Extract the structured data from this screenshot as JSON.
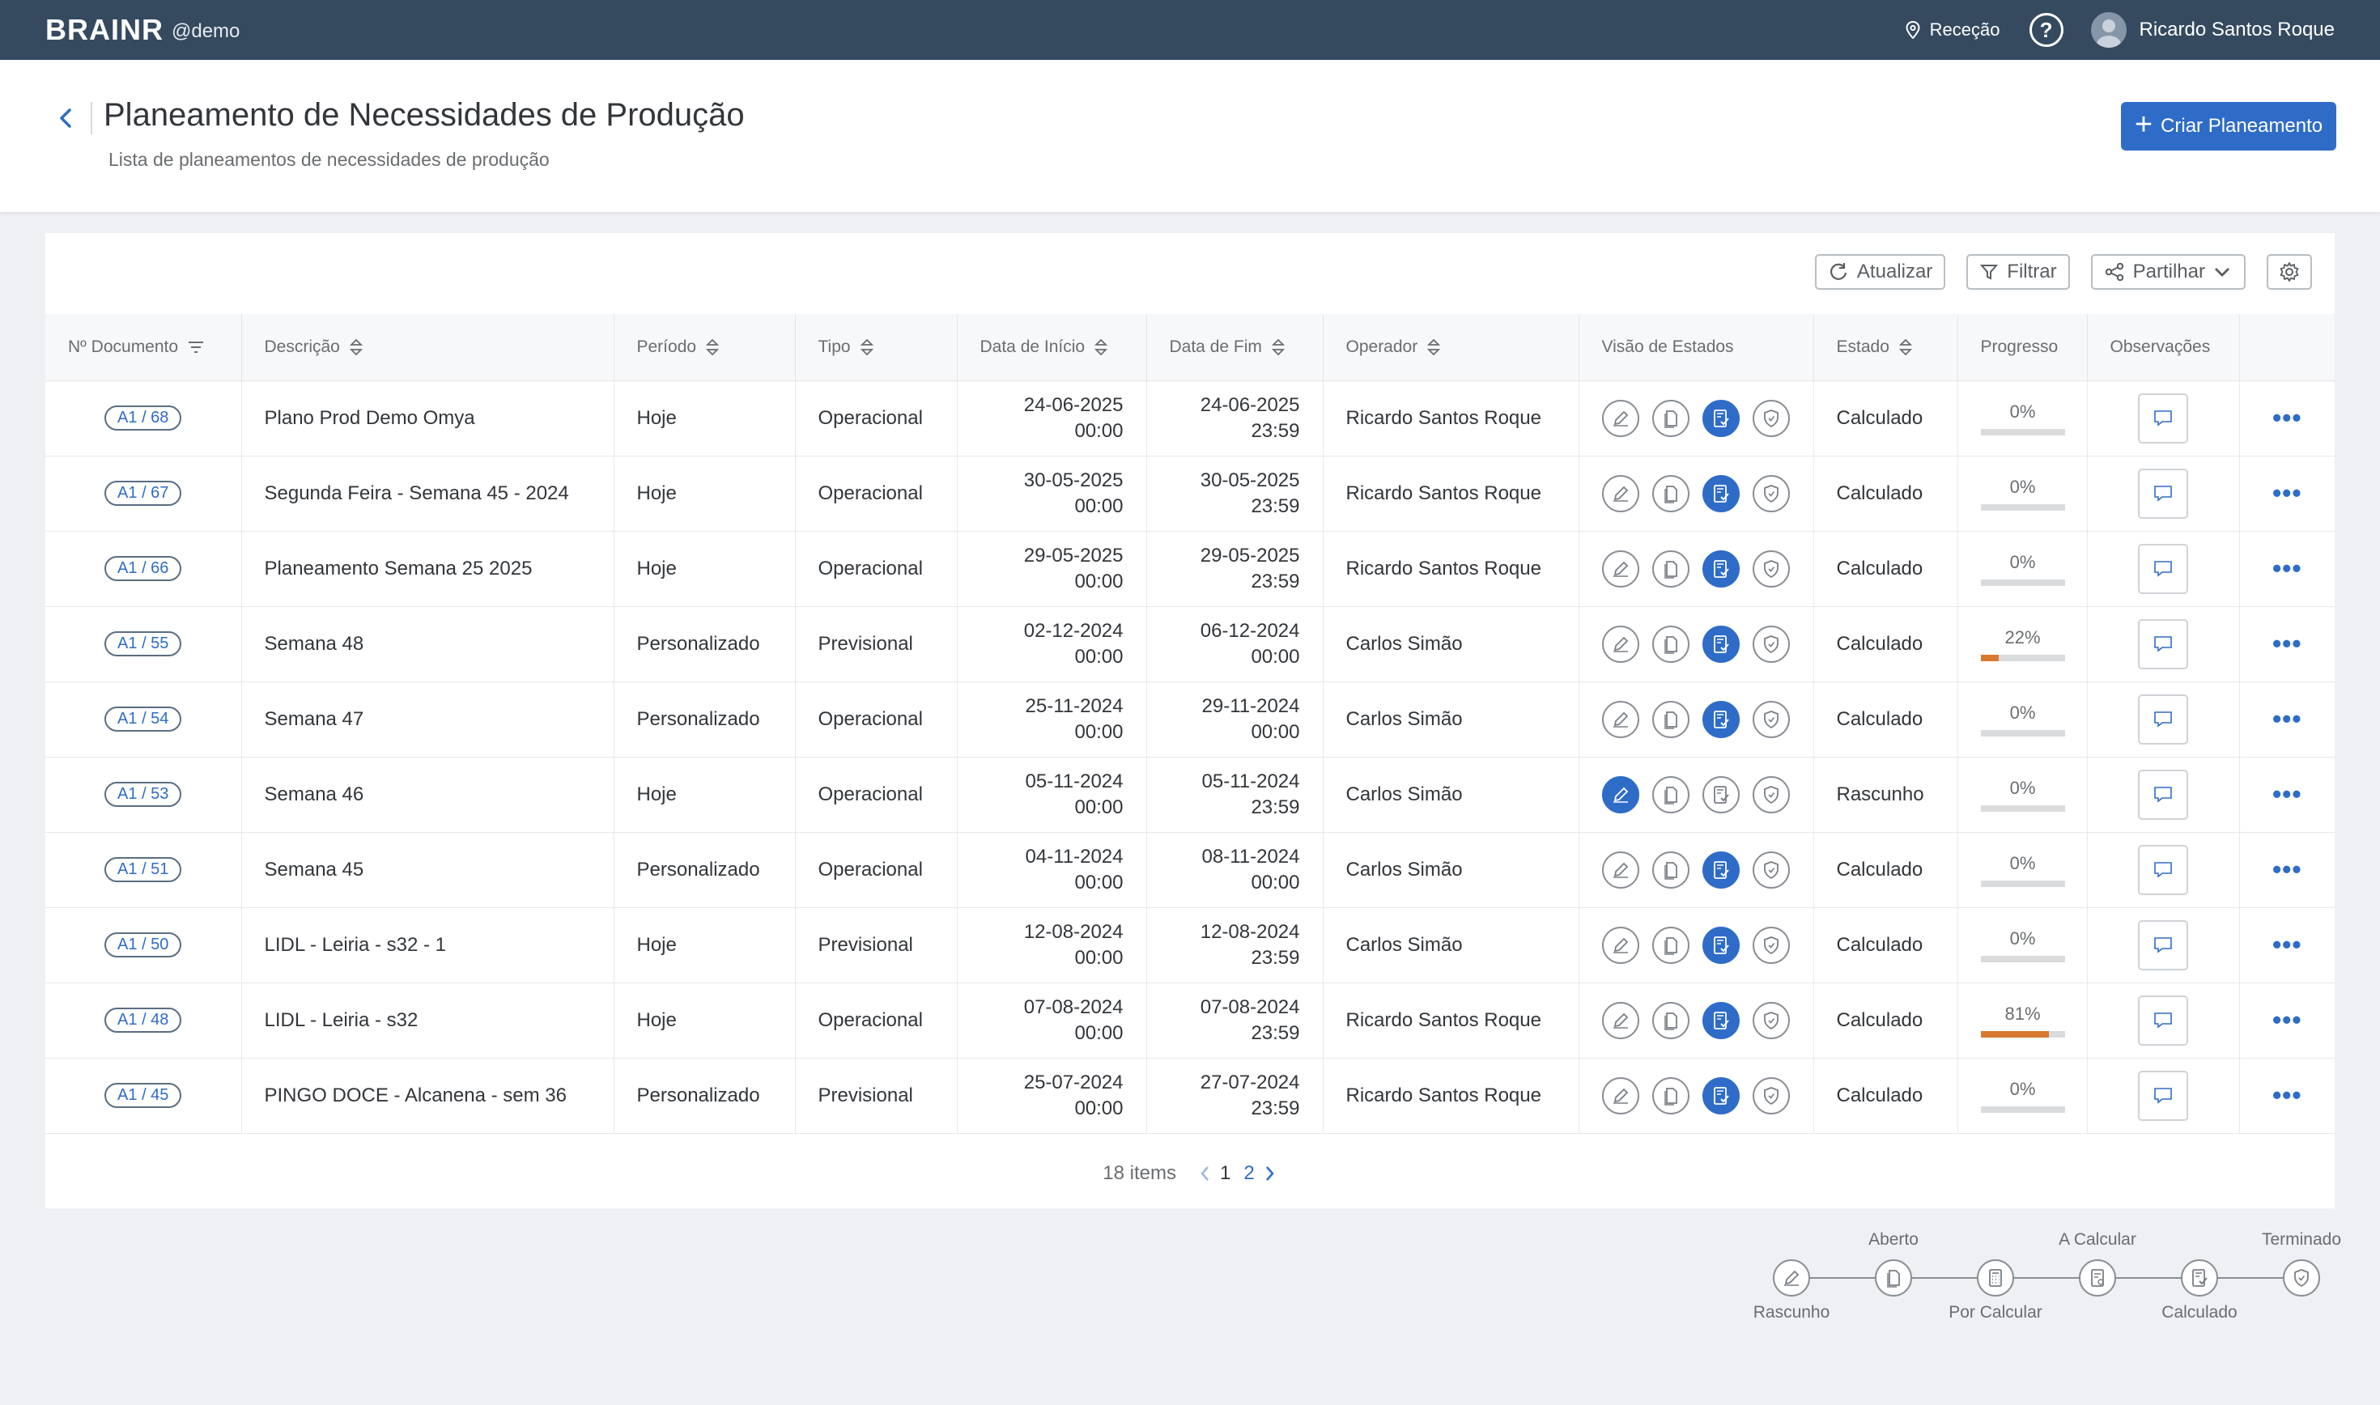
{
  "app": {
    "brand": "BRAINR",
    "tenant": "@demo",
    "location": "Receção",
    "help": "?",
    "user": "Ricardo Santos Roque"
  },
  "header": {
    "title": "Planeamento de Necessidades de Produção",
    "subtitle": "Lista de planeamentos de necessidades de produção",
    "create_label": "Criar Planeamento"
  },
  "toolbar": {
    "refresh": "Atualizar",
    "filter": "Filtrar",
    "share": "Partilhar"
  },
  "columns": [
    "Nº Documento",
    "Descrição",
    "Período",
    "Tipo",
    "Data de Início",
    "Data de Fim",
    "Operador",
    "Visão de Estados",
    "Estado",
    "Progresso",
    "Observações"
  ],
  "rows": [
    {
      "doc": "A1 / 68",
      "desc": "Plano Prod Demo Omya",
      "period": "Hoje",
      "type": "Operacional",
      "start_date": "24-06-2025",
      "start_time": "00:00",
      "end_date": "24-06-2025",
      "end_time": "23:59",
      "operator": "Ricardo Santos Roque",
      "active_state": 2,
      "status": "Calculado",
      "progress": 0,
      "progress_label": "0%"
    },
    {
      "doc": "A1 / 67",
      "desc": "Segunda Feira - Semana 45 - 2024",
      "period": "Hoje",
      "type": "Operacional",
      "start_date": "30-05-2025",
      "start_time": "00:00",
      "end_date": "30-05-2025",
      "end_time": "23:59",
      "operator": "Ricardo Santos Roque",
      "active_state": 2,
      "status": "Calculado",
      "progress": 0,
      "progress_label": "0%"
    },
    {
      "doc": "A1 / 66",
      "desc": "Planeamento Semana 25 2025",
      "period": "Hoje",
      "type": "Operacional",
      "start_date": "29-05-2025",
      "start_time": "00:00",
      "end_date": "29-05-2025",
      "end_time": "23:59",
      "operator": "Ricardo Santos Roque",
      "active_state": 2,
      "status": "Calculado",
      "progress": 0,
      "progress_label": "0%"
    },
    {
      "doc": "A1 / 55",
      "desc": "Semana 48",
      "period": "Personalizado",
      "type": "Previsional",
      "start_date": "02-12-2024",
      "start_time": "00:00",
      "end_date": "06-12-2024",
      "end_time": "00:00",
      "operator": "Carlos Simão",
      "active_state": 2,
      "status": "Calculado",
      "progress": 22,
      "progress_label": "22%"
    },
    {
      "doc": "A1 / 54",
      "desc": "Semana 47",
      "period": "Personalizado",
      "type": "Operacional",
      "start_date": "25-11-2024",
      "start_time": "00:00",
      "end_date": "29-11-2024",
      "end_time": "00:00",
      "operator": "Carlos Simão",
      "active_state": 2,
      "status": "Calculado",
      "progress": 0,
      "progress_label": "0%"
    },
    {
      "doc": "A1 / 53",
      "desc": "Semana 46",
      "period": "Hoje",
      "type": "Operacional",
      "start_date": "05-11-2024",
      "start_time": "00:00",
      "end_date": "05-11-2024",
      "end_time": "23:59",
      "operator": "Carlos Simão",
      "active_state": 0,
      "status": "Rascunho",
      "progress": 0,
      "progress_label": "0%"
    },
    {
      "doc": "A1 / 51",
      "desc": "Semana 45",
      "period": "Personalizado",
      "type": "Operacional",
      "start_date": "04-11-2024",
      "start_time": "00:00",
      "end_date": "08-11-2024",
      "end_time": "00:00",
      "operator": "Carlos Simão",
      "active_state": 2,
      "status": "Calculado",
      "progress": 0,
      "progress_label": "0%"
    },
    {
      "doc": "A1 / 50",
      "desc": "LIDL - Leiria - s32 - 1",
      "period": "Hoje",
      "type": "Previsional",
      "start_date": "12-08-2024",
      "start_time": "00:00",
      "end_date": "12-08-2024",
      "end_time": "23:59",
      "operator": "Carlos Simão",
      "active_state": 2,
      "status": "Calculado",
      "progress": 0,
      "progress_label": "0%"
    },
    {
      "doc": "A1 / 48",
      "desc": "LIDL - Leiria - s32",
      "period": "Hoje",
      "type": "Operacional",
      "start_date": "07-08-2024",
      "start_time": "00:00",
      "end_date": "07-08-2024",
      "end_time": "23:59",
      "operator": "Ricardo Santos Roque",
      "active_state": 2,
      "status": "Calculado",
      "progress": 81,
      "progress_label": "81%"
    },
    {
      "doc": "A1 / 45",
      "desc": "PINGO DOCE - Alcanena - sem 36",
      "period": "Personalizado",
      "type": "Previsional",
      "start_date": "25-07-2024",
      "start_time": "00:00",
      "end_date": "27-07-2024",
      "end_time": "23:59",
      "operator": "Ricardo Santos Roque",
      "active_state": 2,
      "status": "Calculado",
      "progress": 0,
      "progress_label": "0%"
    }
  ],
  "pagination": {
    "items": "18 items",
    "pages": [
      "1",
      "2"
    ],
    "current": "1"
  },
  "legend": [
    "Rascunho",
    "Aberto",
    "Por Calcular",
    "A Calcular",
    "Calculado",
    "Terminado"
  ],
  "colors": {
    "topbar": "#354a5f",
    "accent": "#2f6cc8",
    "progress": "#d8792e"
  },
  "row_icons": [
    "edit-icon",
    "document-icon",
    "calculated-icon",
    "shield-icon"
  ]
}
